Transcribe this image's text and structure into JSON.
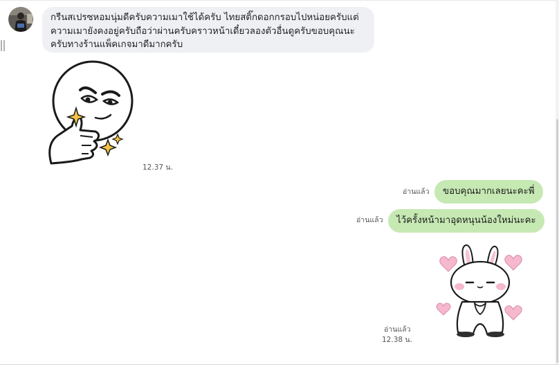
{
  "colors": {
    "incoming_bubble": "#eef0f4",
    "outgoing_bubble": "#c6e9b3",
    "background": "#ffffff",
    "sparkle": "#f5c542",
    "heart": "#f6b8cf"
  },
  "messages": [
    {
      "direction": "incoming",
      "type": "text",
      "avatar": "user-avatar",
      "text": "กรีนสเปรซหอมนุ่มดีครับความเมาใช้ได้ครับ ไทยสติ๊กดอกกรอบไปหน่อยครับแต่\nความเมายังคงอยู่ครับถือว่าผ่านครับคราวหน้าเดี๋ยวลองตัวอื่นดูครับขอบคุณนะ\nครับทางร้านแพ็คเกจมาดีมากครับ"
    },
    {
      "direction": "incoming",
      "type": "sticker",
      "sticker": "moon-face-thinking-sticker",
      "time": "12.37 น."
    },
    {
      "direction": "outgoing",
      "type": "text",
      "text": "ขอบคุณมากเลยนะคะพี่",
      "read": "อ่านแล้ว"
    },
    {
      "direction": "outgoing",
      "type": "text",
      "text": "ไว้ครั้งหน้ามาอุดหนุนน้องใหม่นะคะ",
      "read": "อ่านแล้ว"
    },
    {
      "direction": "outgoing",
      "type": "sticker",
      "sticker": "bunny-hearts-sticker",
      "read": "อ่านแล้ว",
      "time": "12.38 น."
    }
  ]
}
